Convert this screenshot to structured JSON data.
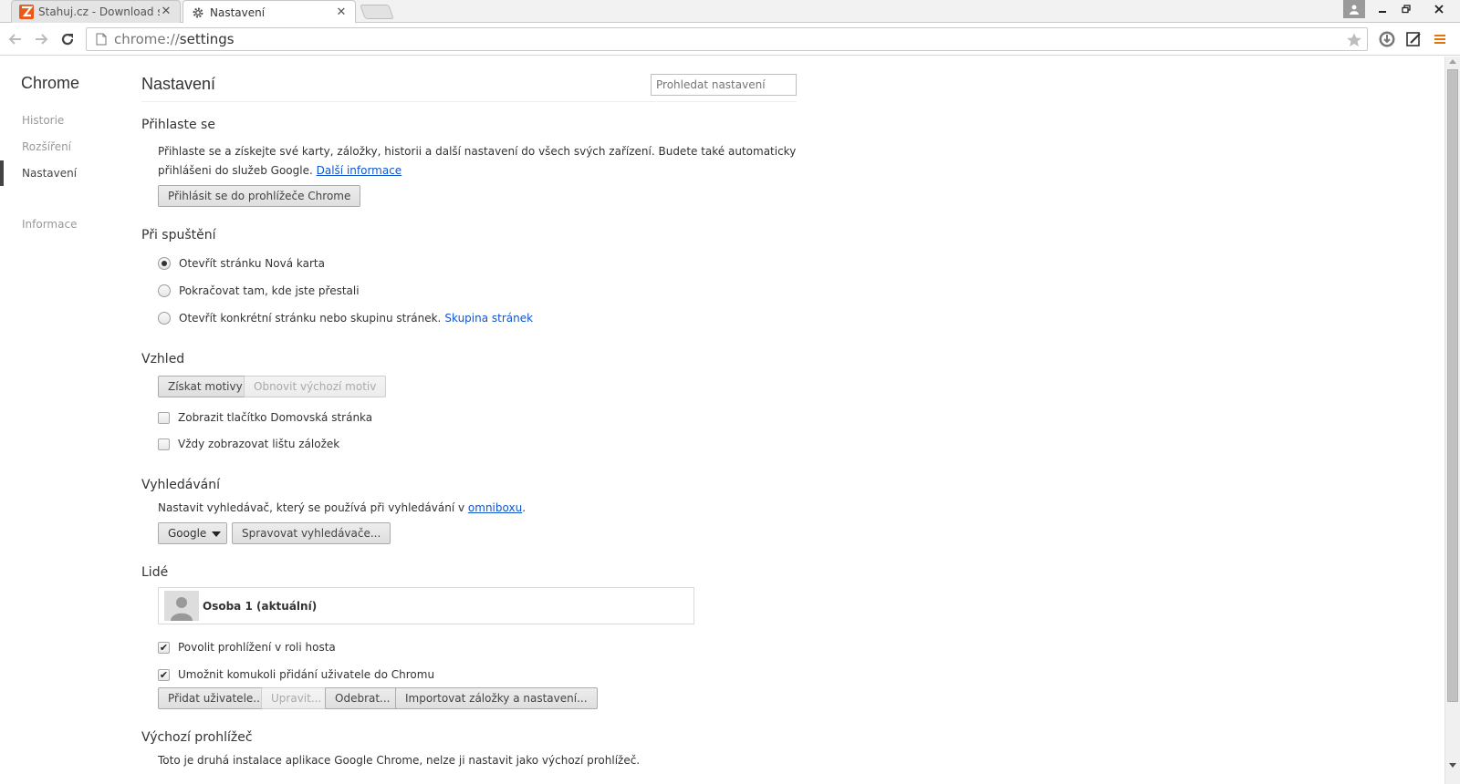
{
  "tabs": [
    {
      "title": "Stahuj.cz - Download sha",
      "icon": "stahuj-logo-icon",
      "active": false
    },
    {
      "title": "Nastavení",
      "icon": "gear-icon",
      "active": true
    }
  ],
  "omnibox": {
    "scheme": "chrome://",
    "path": "settings"
  },
  "sidebar": {
    "title": "Chrome",
    "items": [
      {
        "label": "Historie"
      },
      {
        "label": "Rozšíření"
      },
      {
        "label": "Nastavení"
      },
      {
        "label": "Informace"
      }
    ]
  },
  "main": {
    "title": "Nastavení",
    "search_placeholder": "Prohledat nastavení",
    "signin": {
      "title": "Přihlaste se",
      "text_line1": "Přihlaste se a získejte své karty, záložky, historii a další nastavení do všech svých zařízení. Budete také automaticky",
      "text_line2": "přihlášeni do služeb Google.",
      "link": "Další informace",
      "button": "Přihlásit se do prohlížeče Chrome"
    },
    "startup": {
      "title": "Při spuštění",
      "options": [
        {
          "label": "Otevřít stránku Nová karta",
          "selected": true
        },
        {
          "label": "Pokračovat tam, kde jste přestali",
          "selected": false
        },
        {
          "label": "Otevřít konkrétní stránku nebo skupinu stránek.",
          "selected": false
        }
      ],
      "link": "Skupina stránek"
    },
    "appearance": {
      "title": "Vzhled",
      "get_themes": "Získat motivy",
      "reset_theme": "Obnovit výchozí motiv",
      "checkboxes": [
        {
          "label": "Zobrazit tlačítko Domovská stránka",
          "checked": false
        },
        {
          "label": "Vždy zobrazovat lištu záložek",
          "checked": false
        }
      ]
    },
    "search": {
      "title": "Vyhledávání",
      "text": "Nastavit vyhledávač, který se používá při vyhledávání v",
      "link": "omniboxu",
      "engine": "Google",
      "manage": "Spravovat vyhledávače..."
    },
    "people": {
      "title": "Lidé",
      "profile": "Osoba 1 (aktuální)",
      "checkboxes": [
        {
          "label": "Povolit prohlížení v roli hosta",
          "checked": true
        },
        {
          "label": "Umožnit komukoli přidání uživatele do Chromu",
          "checked": true
        }
      ],
      "buttons": {
        "add": "Přidat uživatele...",
        "edit": "Upravit...",
        "remove": "Odebrat...",
        "import": "Importovat záložky a nastavení..."
      }
    },
    "default_browser": {
      "title": "Výchozí prohlížeč",
      "text": "Toto je druhá instalace aplikace Google Chrome, nelze ji nastavit jako výchozí prohlížeč."
    }
  }
}
